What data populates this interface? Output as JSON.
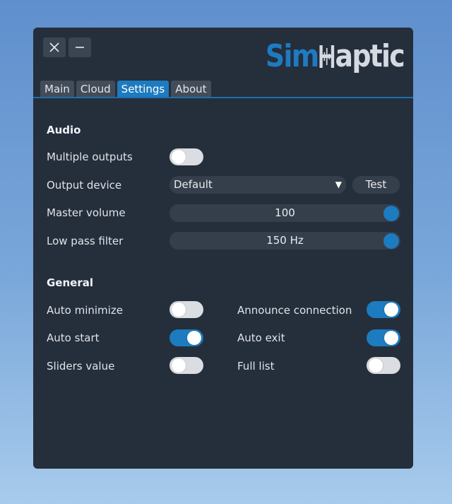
{
  "window": {
    "close_icon": "close-icon",
    "minimize_icon": "minimize-icon"
  },
  "logo": {
    "part1": "Sim",
    "part2": "aptic"
  },
  "tabs": [
    {
      "label": "Main",
      "active": false
    },
    {
      "label": "Cloud",
      "active": false
    },
    {
      "label": "Settings",
      "active": true
    },
    {
      "label": "About",
      "active": false
    }
  ],
  "audio": {
    "title": "Audio",
    "multiple_outputs": {
      "label": "Multiple outputs",
      "on": false
    },
    "output_device": {
      "label": "Output device",
      "value": "Default",
      "test_label": "Test"
    },
    "master_volume": {
      "label": "Master volume",
      "value": "100",
      "level": 1.0
    },
    "low_pass_filter": {
      "label": "Low pass filter",
      "value": "150 Hz",
      "level": 1.0
    }
  },
  "general": {
    "title": "General",
    "auto_minimize": {
      "label": "Auto minimize",
      "on": false
    },
    "auto_start": {
      "label": "Auto start",
      "on": true
    },
    "sliders_value": {
      "label": "Sliders value",
      "on": false
    },
    "announce_connection": {
      "label": "Announce connection",
      "on": true
    },
    "auto_exit": {
      "label": "Auto exit",
      "on": true
    },
    "full_list": {
      "label": "Full list",
      "on": false
    }
  },
  "colors": {
    "accent": "#1d7bbf",
    "window_bg": "#252e3b",
    "control_bg": "#353f4c",
    "toggle_off": "#dadde2"
  }
}
